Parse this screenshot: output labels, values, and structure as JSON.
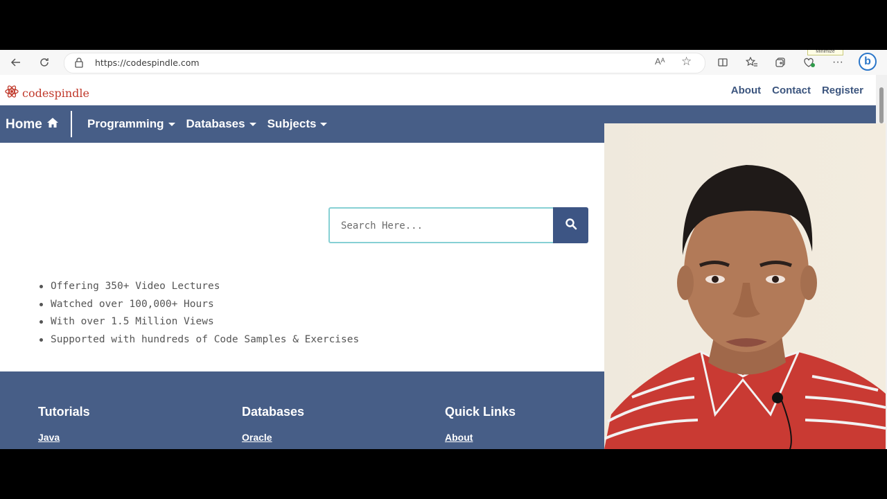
{
  "browser": {
    "url": "https://codespindle.com",
    "tooltip": "Minimize",
    "icons": [
      "back-arrow-icon",
      "refresh-icon",
      "lock-icon",
      "read-aloud-icon",
      "star-icon",
      "split-screen-icon",
      "favorites-icon",
      "collections-icon",
      "extensions-icon",
      "more-icon",
      "bing-icon"
    ],
    "read_aloud_glyph": "Aᴬ",
    "bing_glyph": "b"
  },
  "site": {
    "logo_text": "codespindle",
    "top_links": [
      "About",
      "Contact",
      "Register"
    ],
    "nav": {
      "home": "Home",
      "items": [
        "Programming",
        "Databases",
        "Subjects"
      ]
    },
    "search": {
      "placeholder": "Search Here..."
    },
    "bullets": [
      "Offering 350+ Video Lectures",
      "Watched over 100,000+ Hours",
      "With over 1.5 Million Views",
      "Supported with hundreds of Code Samples & Exercises"
    ],
    "footer": {
      "columns": [
        {
          "heading": "Tutorials",
          "link": "Java"
        },
        {
          "heading": "Databases",
          "link": "Oracle"
        },
        {
          "heading": "Quick Links",
          "link": "About"
        }
      ]
    }
  },
  "colors": {
    "nav_bg": "#475e87",
    "link_color": "#3c557e",
    "logo_red": "#c0392b",
    "search_button": "#3d5584"
  }
}
